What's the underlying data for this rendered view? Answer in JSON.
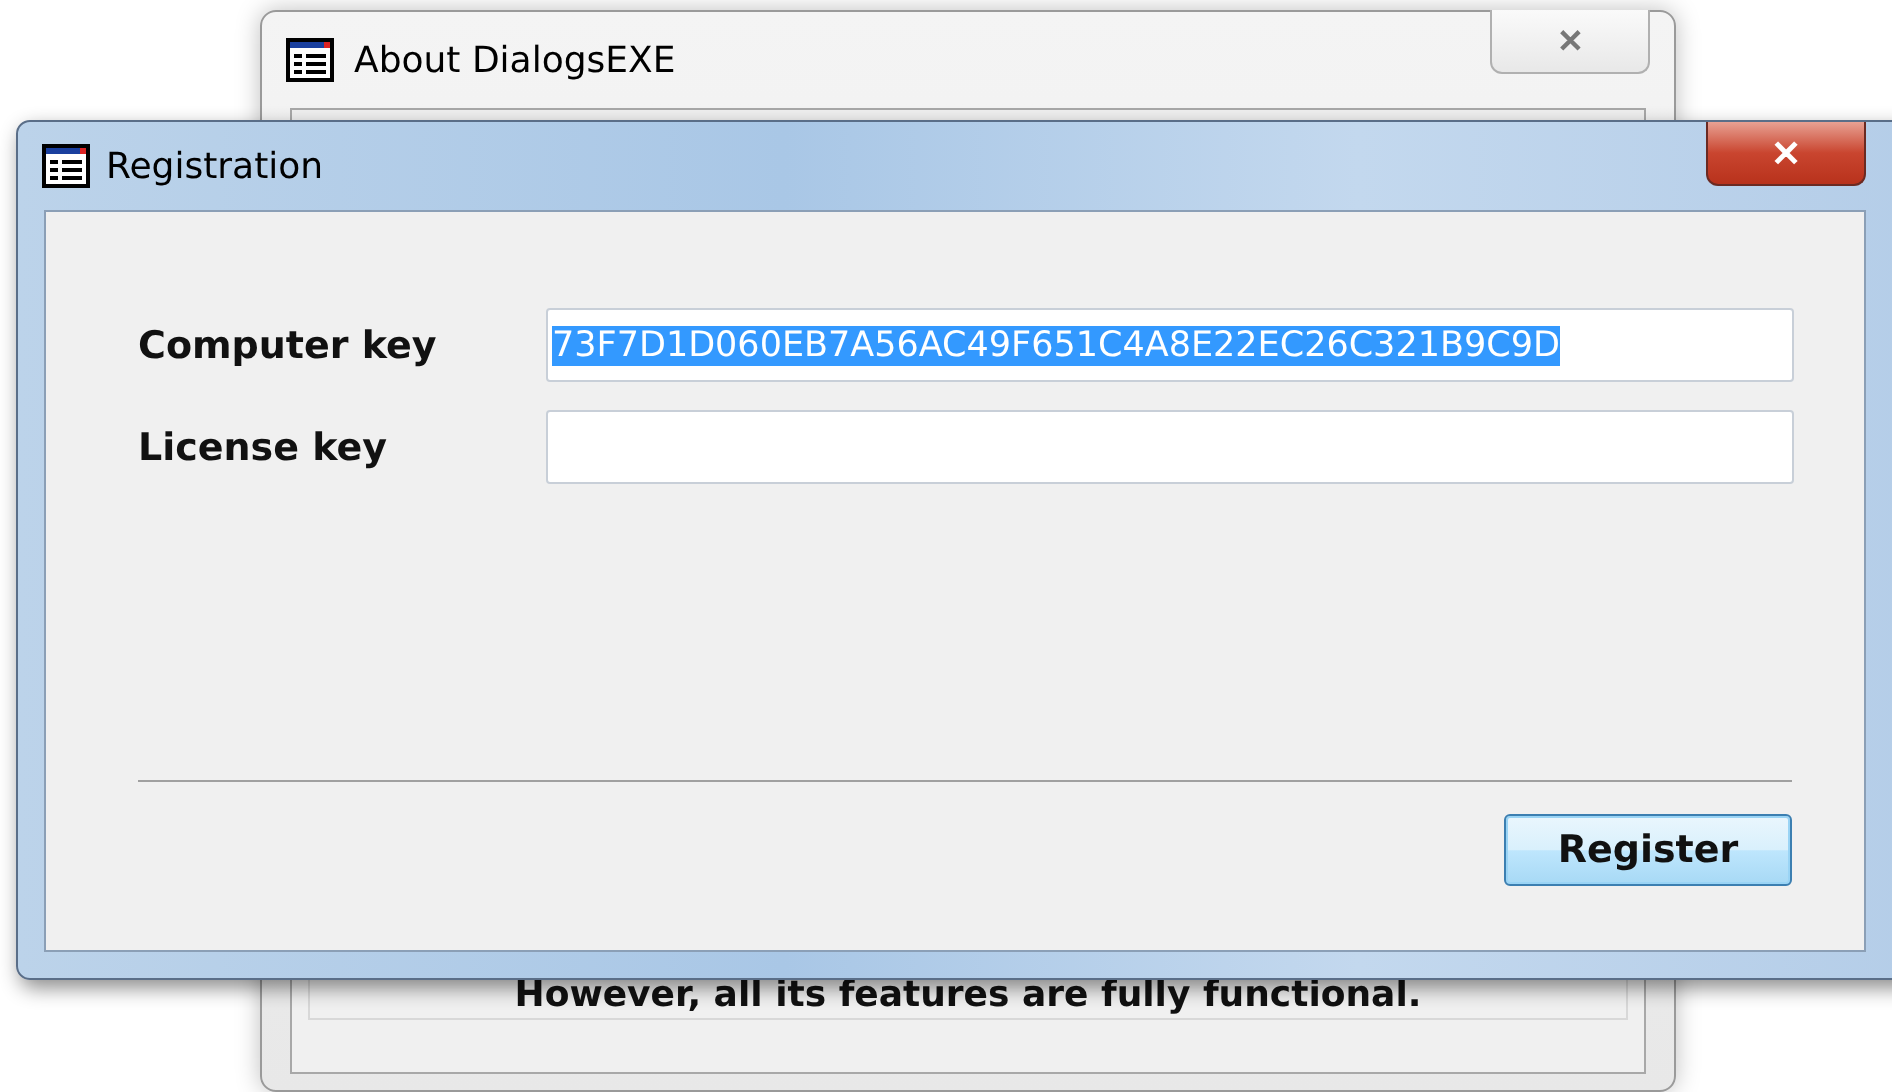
{
  "background_window": {
    "title": "About DialogsEXE",
    "close": "✕",
    "footer_text": "However, all its features are fully functional."
  },
  "window": {
    "title": "Registration",
    "close": "✕"
  },
  "fields": [
    {
      "label": "Computer key",
      "value": "73F7D1D060EB7A56AC49F651C4A8E22EC26C321B9C9D",
      "text_selected": true
    },
    {
      "label": "License key"
    }
  ],
  "buttons": [
    {
      "label": "Register",
      "focused": true
    }
  ]
}
